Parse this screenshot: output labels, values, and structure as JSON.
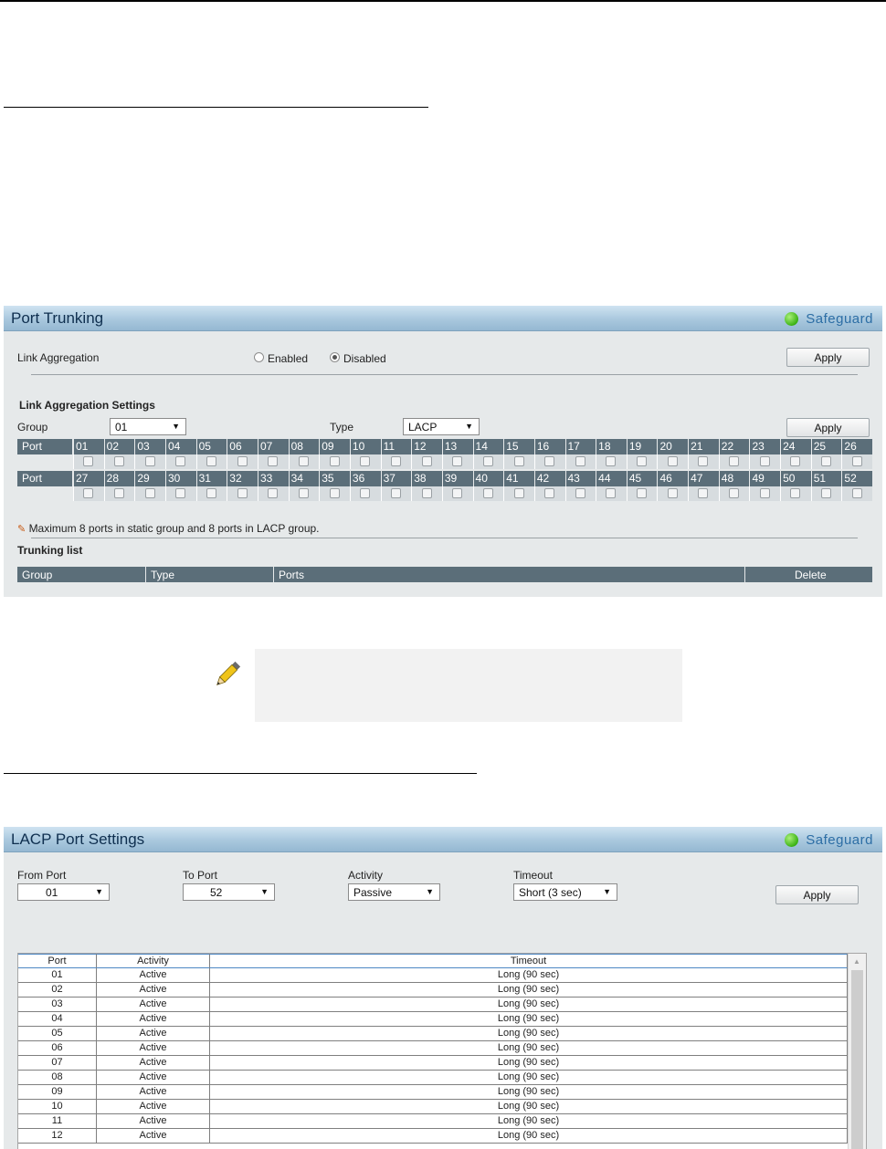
{
  "port_trunking": {
    "title": "Port Trunking",
    "safeguard": "Safeguard",
    "link_aggregation_label": "Link Aggregation",
    "enabled_label": "Enabled",
    "disabled_label": "Disabled",
    "selected_state": "Disabled",
    "apply_label": "Apply",
    "settings_heading": "Link Aggregation Settings",
    "group_label": "Group",
    "group_value": "01",
    "type_label": "Type",
    "type_value": "LACP",
    "apply2_label": "Apply",
    "port_header": "Port",
    "ports_row1": [
      "01",
      "02",
      "03",
      "04",
      "05",
      "06",
      "07",
      "08",
      "09",
      "10",
      "11",
      "12",
      "13",
      "14",
      "15",
      "16",
      "17",
      "18",
      "19",
      "20",
      "21",
      "22",
      "23",
      "24",
      "25",
      "26"
    ],
    "ports_row2": [
      "27",
      "28",
      "29",
      "30",
      "31",
      "32",
      "33",
      "34",
      "35",
      "36",
      "37",
      "38",
      "39",
      "40",
      "41",
      "42",
      "43",
      "44",
      "45",
      "46",
      "47",
      "48",
      "49",
      "50",
      "51",
      "52"
    ],
    "note": "Maximum 8 ports in static group and 8 ports in LACP group.",
    "trunking_list_heading": "Trunking list",
    "list_columns": {
      "group": "Group",
      "type": "Type",
      "ports": "Ports",
      "delete": "Delete"
    }
  },
  "lacp": {
    "title": "LACP Port Settings",
    "safeguard": "Safeguard",
    "from_port_label": "From Port",
    "from_port_value": "01",
    "to_port_label": "To Port",
    "to_port_value": "52",
    "activity_label": "Activity",
    "activity_value": "Passive",
    "timeout_label": "Timeout",
    "timeout_value": "Short (3 sec)",
    "apply_label": "Apply",
    "table": {
      "columns": [
        "Port",
        "Activity",
        "Timeout"
      ],
      "rows": [
        [
          "01",
          "Active",
          "Long (90 sec)"
        ],
        [
          "02",
          "Active",
          "Long (90 sec)"
        ],
        [
          "03",
          "Active",
          "Long (90 sec)"
        ],
        [
          "04",
          "Active",
          "Long (90 sec)"
        ],
        [
          "05",
          "Active",
          "Long (90 sec)"
        ],
        [
          "06",
          "Active",
          "Long (90 sec)"
        ],
        [
          "07",
          "Active",
          "Long (90 sec)"
        ],
        [
          "08",
          "Active",
          "Long (90 sec)"
        ],
        [
          "09",
          "Active",
          "Long (90 sec)"
        ],
        [
          "10",
          "Active",
          "Long (90 sec)"
        ],
        [
          "11",
          "Active",
          "Long (90 sec)"
        ],
        [
          "12",
          "Active",
          "Long (90 sec)"
        ]
      ]
    }
  },
  "colors": {
    "header_gradient_mid": "#a9c8de",
    "grid_header": "#5b6e79",
    "safeguard_green": "#3bb214",
    "safeguard_text": "#2d6ea5"
  }
}
